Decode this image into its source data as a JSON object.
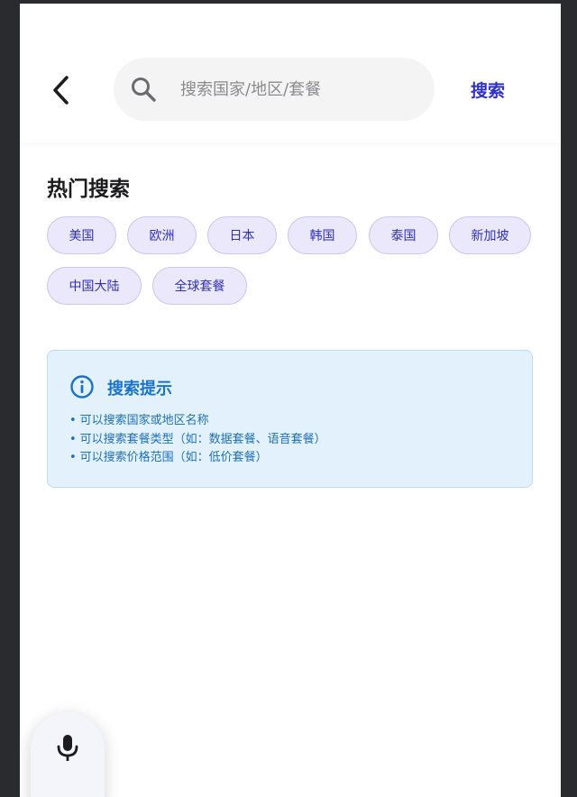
{
  "header": {
    "back_icon": "chevron-left-icon",
    "search": {
      "icon": "search-icon",
      "placeholder": "搜索国家/地区/套餐",
      "value": ""
    },
    "search_button_label": "搜索"
  },
  "hot_search": {
    "title": "热门搜索",
    "tags": [
      "美国",
      "欧洲",
      "日本",
      "韩国",
      "泰国",
      "新加坡",
      "中国大陆",
      "全球套餐"
    ]
  },
  "tips": {
    "icon": "info-icon",
    "title": "搜索提示",
    "items": [
      "可以搜索国家或地区名称",
      "可以搜索套餐类型（如：数据套餐、语音套餐）",
      "可以搜索价格范围（如：低价套餐）"
    ]
  },
  "voice": {
    "icon": "microphone-icon"
  },
  "colors": {
    "accent": "#2f2fc9",
    "tag_bg": "#ebe8fb",
    "tip_bg": "#e3f1fc",
    "tip_text": "#1a73c9"
  }
}
